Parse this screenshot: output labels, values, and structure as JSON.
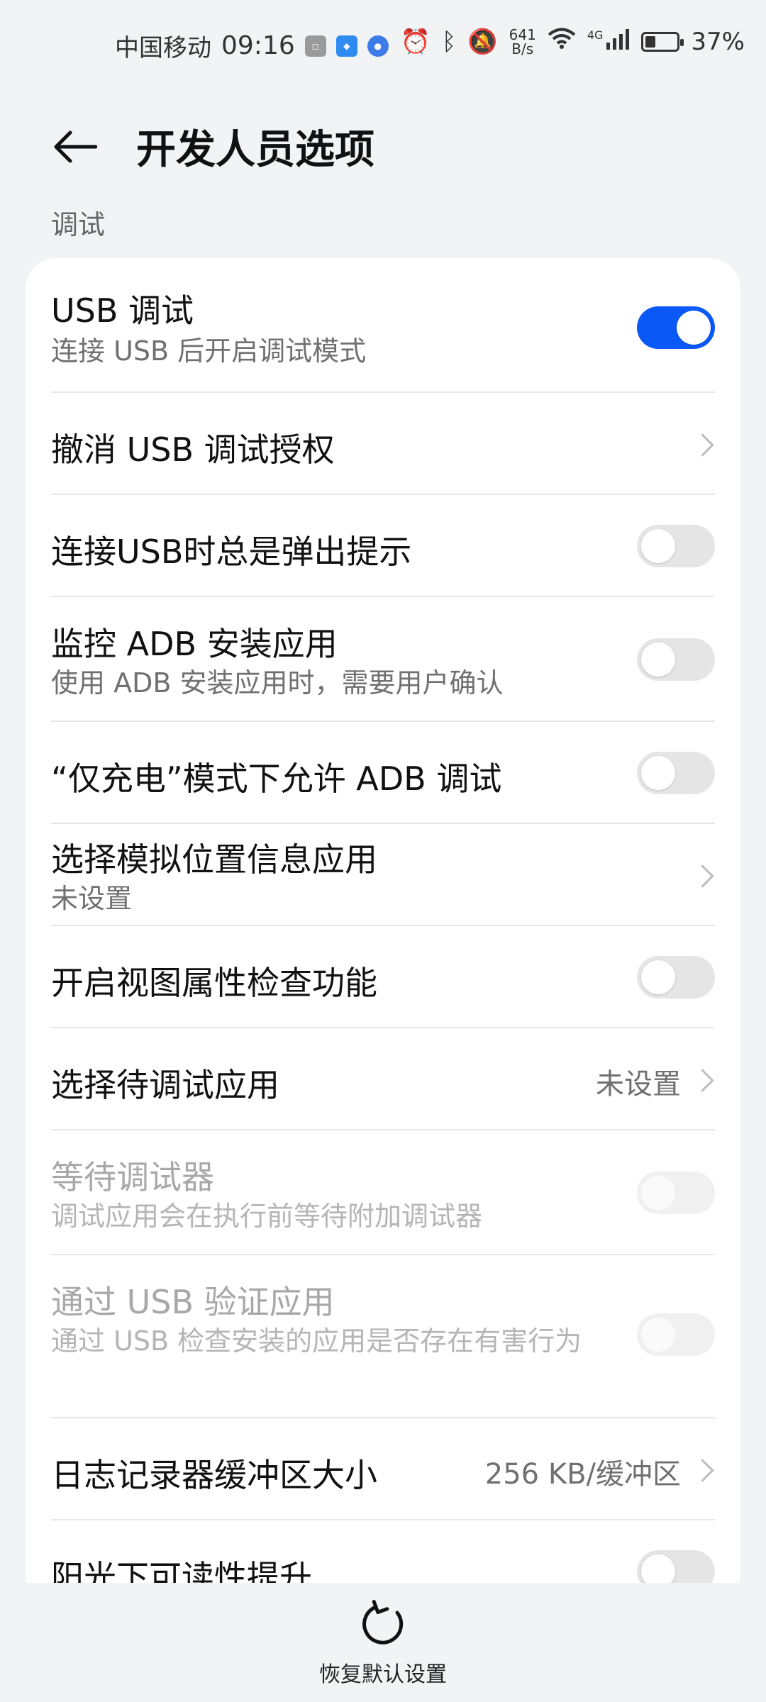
{
  "status_bar": {
    "carrier": "中国移动",
    "time": "09:16",
    "net_speed_value": "641",
    "net_speed_unit": "B/s",
    "signal_tag": "4G",
    "battery": "37%"
  },
  "header": {
    "title": "开发人员选项"
  },
  "section": {
    "label": "调试"
  },
  "items": [
    {
      "title": "USB 调试",
      "subtitle": "连接 USB 后开启调试模式",
      "control": "toggle",
      "on": true
    },
    {
      "title": "撤消 USB 调试授权",
      "control": "chevron"
    },
    {
      "title": "连接USB时总是弹出提示",
      "control": "toggle",
      "on": false
    },
    {
      "title": "监控 ADB 安装应用",
      "subtitle": "使用 ADB 安装应用时，需要用户确认",
      "control": "toggle",
      "on": false
    },
    {
      "title": "“仅充电”模式下允许 ADB 调试",
      "control": "toggle",
      "on": false
    },
    {
      "title": "选择模拟位置信息应用",
      "subtitle": "未设置",
      "control": "chevron"
    },
    {
      "title": "开启视图属性检查功能",
      "control": "toggle",
      "on": false
    },
    {
      "title": "选择待调试应用",
      "value": "未设置",
      "control": "chevron"
    },
    {
      "title": "等待调试器",
      "subtitle": "调试应用会在执行前等待附加调试器",
      "control": "toggle",
      "on": false,
      "disabled": true
    },
    {
      "title": "通过 USB 验证应用",
      "subtitle": "通过 USB 检查安装的应用是否存在有害行为",
      "control": "toggle",
      "on": false,
      "disabled": true
    },
    {
      "title": "日志记录器缓冲区大小",
      "value": "256 KB/缓冲区",
      "control": "chevron"
    },
    {
      "title": "阳光下可读性提升",
      "control": "toggle",
      "on": false
    }
  ],
  "bottom": {
    "restore_label": "恢复默认设置"
  },
  "colors": {
    "accent": "#0a59f7",
    "background": "#f1f3f5",
    "card": "#ffffff"
  }
}
